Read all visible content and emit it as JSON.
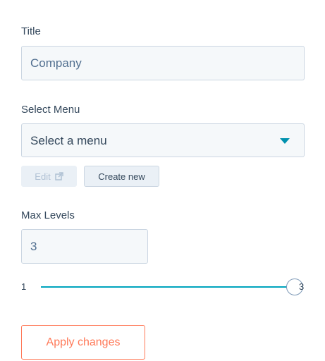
{
  "title_field": {
    "label": "Title",
    "value": "Company"
  },
  "menu_select": {
    "label": "Select Menu",
    "selected": "Select a menu",
    "icon": "caret-down-icon"
  },
  "menu_actions": {
    "edit_label": "Edit",
    "edit_icon": "external-link-icon",
    "edit_disabled": true,
    "create_label": "Create new"
  },
  "max_levels": {
    "label": "Max Levels",
    "value": "3",
    "slider": {
      "min_label": "1",
      "max_label": "3",
      "min": 1,
      "max": 3,
      "value": 3
    }
  },
  "apply_button": {
    "label": "Apply changes"
  },
  "colors": {
    "accent_teal": "#00a4bd",
    "caret": "#0091ae",
    "primary_orange": "#ff7a59",
    "text": "#33475b",
    "field_bg": "#f5f8fa",
    "border": "#cbd6e2"
  }
}
